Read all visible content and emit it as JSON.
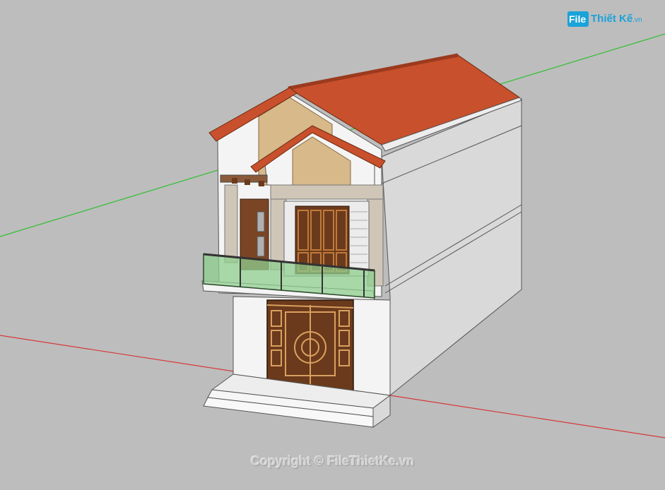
{
  "watermark": {
    "text": "Copyright © FileThietKe.vn"
  },
  "logo": {
    "badge": "File",
    "name": "Thiết Kế",
    "tld": ".vn"
  },
  "scene": {
    "axis_colors": {
      "red": "#d63a3a",
      "green": "#2fbf2f"
    },
    "colors": {
      "background": "#bdbdbd",
      "wall_white": "#f4f4f4",
      "wall_side": "#d9d9d9",
      "wall_shadow": "#c8c8c8",
      "roof_tile": "#c8502c",
      "roof_dark": "#9c3a1e",
      "stone": "#d7b98a",
      "wood_door": "#6b3a1c",
      "glass": "#8fcf8f",
      "steps": "#e9e9e9"
    }
  }
}
